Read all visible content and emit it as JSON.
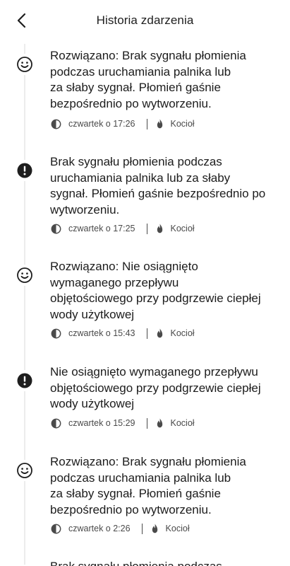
{
  "header": {
    "title": "Historia zdarzenia"
  },
  "events": [
    {
      "status": "resolved",
      "text": "Rozwiązano: Brak sygnału płomienia\npodczas uruchamiania palnika lub\nza słaby sygnał. Płomień gaśnie\nbezpośrednio po wytworzeniu.",
      "time": "czwartek o 17:26",
      "device": "Kocioł"
    },
    {
      "status": "error",
      "text": "Brak sygnału płomienia podczas\nuruchamiania palnika lub za słaby\nsygnał. Płomień gaśnie bezpośrednio po\nwytworzeniu.",
      "time": "czwartek o 17:25",
      "device": "Kocioł"
    },
    {
      "status": "resolved",
      "text": "Rozwiązano: Nie osiągnięto\nwymaganego przepływu\nobjętościowego przy podgrzewie ciepłej\nwody użytkowej",
      "time": "czwartek o 15:43",
      "device": "Kocioł"
    },
    {
      "status": "error",
      "text": "Nie osiągnięto wymaganego przepływu\nobjętościowego przy podgrzewie ciepłej\nwody użytkowej",
      "time": "czwartek o 15:29",
      "device": "Kocioł"
    },
    {
      "status": "resolved",
      "text": "Rozwiązano: Brak sygnału płomienia\npodczas uruchamiania palnika lub\nza słaby sygnał. Płomień gaśnie\nbezpośrednio po wytworzeniu.",
      "time": "czwartek o 2:26",
      "device": "Kocioł"
    },
    {
      "status": "error",
      "text": "Brak sygnału płomienia podczas",
      "time": "",
      "device": ""
    }
  ],
  "icons": {
    "back": "chevron-left-icon",
    "resolved": "smiley-icon",
    "error": "exclamation-icon",
    "time": "clock-icon",
    "device": "flame-icon"
  },
  "colors": {
    "text": "#1c1c1c",
    "meta": "#4a4a4a",
    "icon": "#1e1e1e",
    "timeline": "#ececec"
  }
}
